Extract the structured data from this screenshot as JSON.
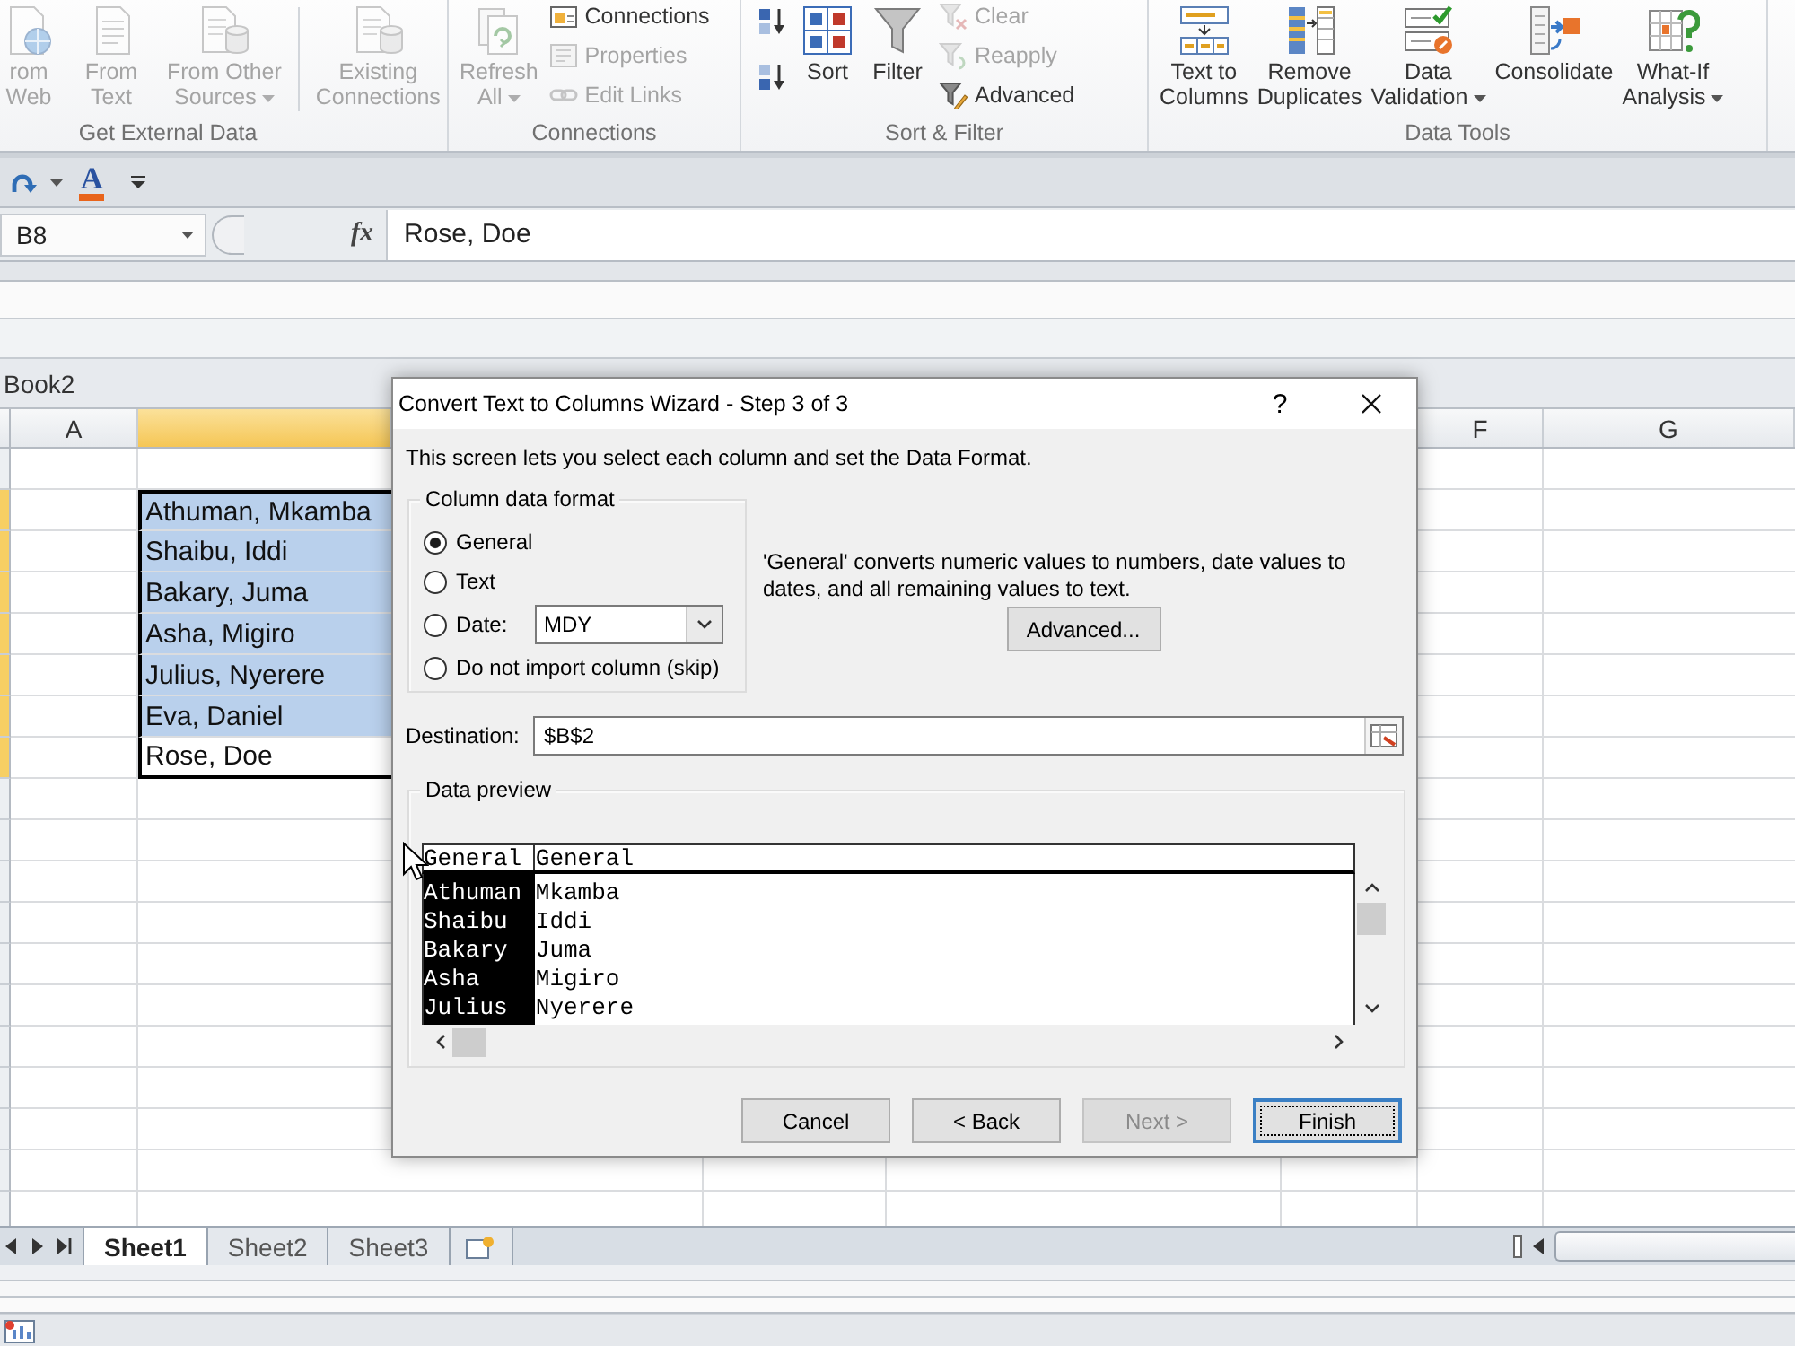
{
  "ribbon": {
    "groups": [
      {
        "label": "Get External Data",
        "items": [
          {
            "kind": "large",
            "label": "rom\nWeb",
            "disabled": true
          },
          {
            "kind": "large",
            "label": "From\nText",
            "disabled": true
          },
          {
            "kind": "large",
            "label": "From Other\nSources",
            "disabled": true,
            "dropdown": true
          },
          {
            "kind": "large",
            "label": "Existing\nConnections",
            "disabled": true,
            "separated": true
          }
        ]
      },
      {
        "label": "Connections",
        "items": [
          {
            "kind": "large",
            "label": "Refresh\nAll",
            "disabled": true,
            "dropdown": true
          },
          {
            "kind": "small",
            "label": "Connections",
            "disabled": false
          },
          {
            "kind": "small",
            "label": "Properties",
            "disabled": true
          },
          {
            "kind": "small",
            "label": "Edit Links",
            "disabled": true
          }
        ]
      },
      {
        "label": "Sort & Filter",
        "items": [
          {
            "kind": "small",
            "disabled": false
          },
          {
            "kind": "small",
            "disabled": false
          },
          {
            "kind": "large",
            "label": "Sort",
            "disabled": false
          },
          {
            "kind": "large",
            "label": "Filter",
            "disabled": false
          },
          {
            "kind": "small",
            "label": "Clear",
            "disabled": true
          },
          {
            "kind": "small",
            "label": "Reapply",
            "disabled": true
          },
          {
            "kind": "small",
            "label": "Advanced",
            "disabled": false
          }
        ]
      },
      {
        "label": "Data Tools",
        "items": [
          {
            "kind": "large",
            "label": "Text to\nColumns",
            "disabled": false
          },
          {
            "kind": "large",
            "label": "Remove\nDuplicates",
            "disabled": false
          },
          {
            "kind": "large",
            "label": "Data\nValidation",
            "disabled": false,
            "dropdown": true
          },
          {
            "kind": "large",
            "label": "Consolidate",
            "disabled": false
          },
          {
            "kind": "large",
            "label": "What-If\nAnalysis",
            "disabled": false,
            "dropdown": true
          }
        ]
      }
    ]
  },
  "quick_access": {
    "font_color_glyph": "A"
  },
  "formula_bar": {
    "name_box": "B8",
    "function_label": "fx",
    "value": "Rose, Doe"
  },
  "workbook": {
    "title": "Book2"
  },
  "sheet": {
    "columns": [
      {
        "label": "A",
        "selected": false
      },
      {
        "selected": true
      },
      {
        "label": "F",
        "selected": false
      },
      {
        "label": "G",
        "selected": false
      }
    ],
    "rows": [
      {
        "selected": false
      },
      {
        "selected": true,
        "active": false,
        "value": "Athuman, Mkamba"
      },
      {
        "selected": true,
        "active": false,
        "value": "Shaibu, Iddi"
      },
      {
        "selected": true,
        "active": false,
        "value": "Bakary, Juma"
      },
      {
        "selected": true,
        "active": false,
        "value": "Asha, Migiro"
      },
      {
        "selected": true,
        "active": false,
        "value": "Julius, Nyerere"
      },
      {
        "selected": true,
        "active": false,
        "value": "Eva, Daniel"
      },
      {
        "selected": true,
        "active": true,
        "value": "Rose, Doe"
      }
    ]
  },
  "sheet_tabs": [
    {
      "label": "Sheet1",
      "selected": true
    },
    {
      "label": "Sheet2",
      "selected": false
    },
    {
      "label": "Sheet3",
      "selected": false
    }
  ],
  "dialog": {
    "title": "Convert Text to Columns Wizard - Step 3 of 3",
    "help_label": "?",
    "description": "This screen lets you select each column and set the Data Format.",
    "format_group": {
      "label": "Column data format",
      "options": [
        {
          "kind": "plain",
          "label": "General",
          "selected": true
        },
        {
          "kind": "plain",
          "label": "Text",
          "selected": false
        },
        {
          "kind": "date",
          "label": "Date:",
          "selected": false,
          "dropdown_value": "MDY"
        },
        {
          "kind": "plain",
          "label": "Do not import column (skip)",
          "selected": false
        }
      ]
    },
    "format_note": "'General' converts numeric values to numbers, date values to dates, and all remaining values to text.",
    "advanced_button": {
      "label": "Advanced..."
    },
    "destination": {
      "label": "Destination:",
      "value": "$B$2"
    },
    "preview": {
      "label": "Data preview",
      "columns": [
        {
          "header": "General",
          "selected": true,
          "values": [
            "Athuman",
            "Shaibu",
            "Bakary",
            "Asha",
            "Julius"
          ]
        },
        {
          "header": "General",
          "selected": false,
          "values": [
            "Mkamba",
            "Iddi",
            "Juma",
            "Migiro",
            "Nyerere"
          ]
        }
      ]
    },
    "buttons": [
      {
        "label": "Cancel",
        "disabled": false,
        "default": false
      },
      {
        "label": "< Back",
        "disabled": false,
        "default": false
      },
      {
        "label": "Next >",
        "disabled": true,
        "default": false
      },
      {
        "label": "Finish",
        "disabled": false,
        "default": true
      }
    ]
  }
}
